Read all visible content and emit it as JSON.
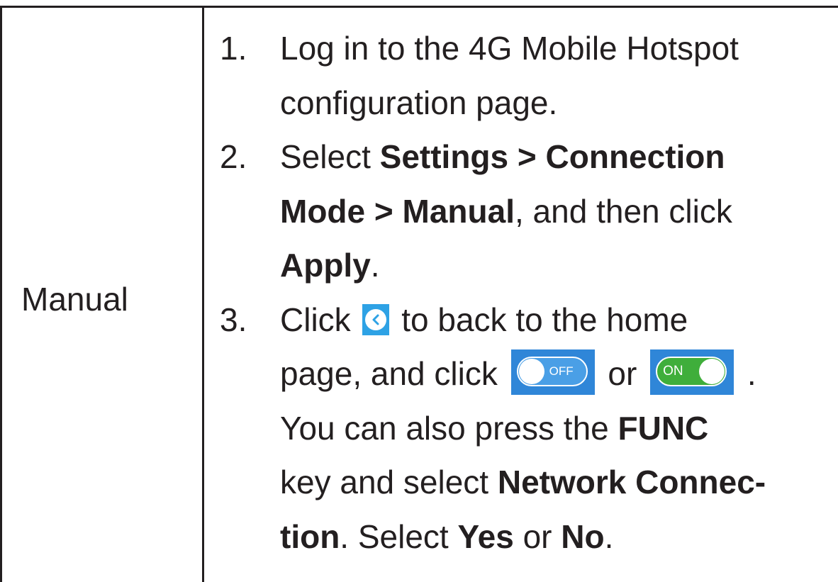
{
  "mode": "Manual",
  "steps": {
    "s1": {
      "num": "1.",
      "a": "Log in to the 4G Mobile Hotspot",
      "b": "configuration page."
    },
    "s2": {
      "num": "2.",
      "pre": "Select ",
      "b1": "Settings > Connection",
      "b2": "Mode > Manual",
      "mid": ", and then click",
      "b3": "Apply",
      "end": "."
    },
    "s3": {
      "num": "3.",
      "click": "Click",
      "after_back": " to back to the home",
      "page_click": "page, and click",
      "or": " or ",
      "period": " .",
      "also": "You can also press the ",
      "func": "FUNC",
      "key_select": "key and select ",
      "netconn": "Network Connec-",
      "tion": "tion",
      "select": ". Select ",
      "yes": "Yes",
      "or2": " or ",
      "no": "No",
      "end": "."
    }
  },
  "icons": {
    "back": "chevron-left-icon",
    "toggle_off_label": "OFF",
    "toggle_on_label": "ON",
    "back_color": "#2ea2e5",
    "off_color": "#2f86d8",
    "on_color": "#3fae3b"
  }
}
